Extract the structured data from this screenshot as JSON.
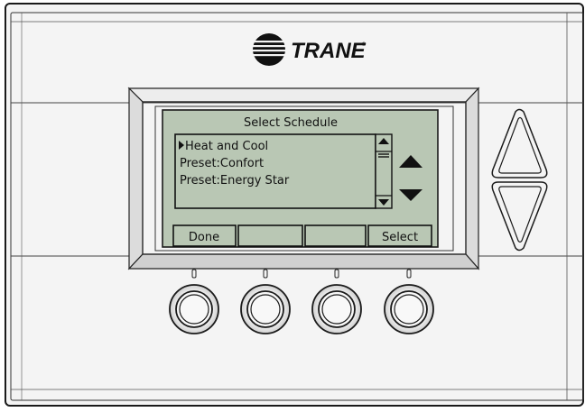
{
  "brand": {
    "name": "TRANE",
    "trademark": "®"
  },
  "screen": {
    "title": "Select Schedule",
    "selected_index": 0,
    "items": [
      {
        "label": "Heat and Cool"
      },
      {
        "label": "Preset:Confort"
      },
      {
        "label": "Preset:Energy Star"
      }
    ],
    "softkeys": [
      "Done",
      "",
      "",
      "Select"
    ]
  },
  "colors": {
    "lcd_background": "#b9c7b4",
    "body": "#f4f4f4",
    "outline": "#1a1a1a"
  }
}
